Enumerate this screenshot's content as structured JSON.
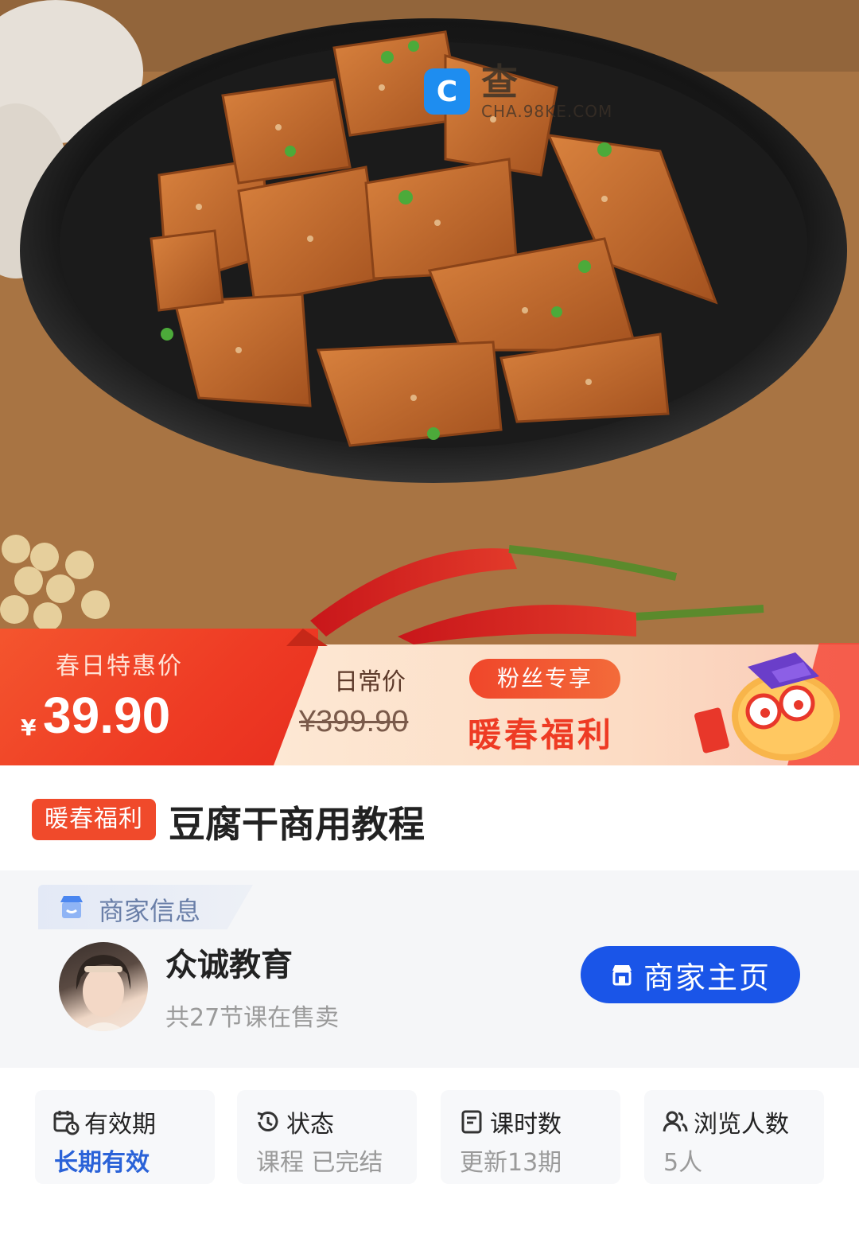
{
  "watermark": {
    "logo_glyph": "C",
    "cn": "查",
    "en": "CHA.98KE.COM"
  },
  "promo": {
    "label": "春日特惠价",
    "currency": "¥",
    "price": "39.90",
    "regular_label": "日常价",
    "regular_price": "¥399.90",
    "fan_badge": "粉丝专享",
    "slogan": "暖春福利"
  },
  "product": {
    "tag": "暖春福利",
    "title": "豆腐干商用教程"
  },
  "merchant": {
    "section_label": "商家信息",
    "name": "众诚教育",
    "courses": "共27节课在售卖",
    "store_button": "商家主页"
  },
  "stats": [
    {
      "label": "有效期",
      "value": "长期有效",
      "icon": "calendar-clock-icon"
    },
    {
      "label": "状态",
      "value": "课程 已完结",
      "icon": "history-icon"
    },
    {
      "label": "课时数",
      "value": "更新13期",
      "icon": "document-icon"
    },
    {
      "label": "浏览人数",
      "value": "5人",
      "icon": "users-icon"
    }
  ],
  "colors": {
    "accent_red": "#ee3b24",
    "brand_blue": "#1a55e8",
    "link_blue": "#2a62d8"
  }
}
